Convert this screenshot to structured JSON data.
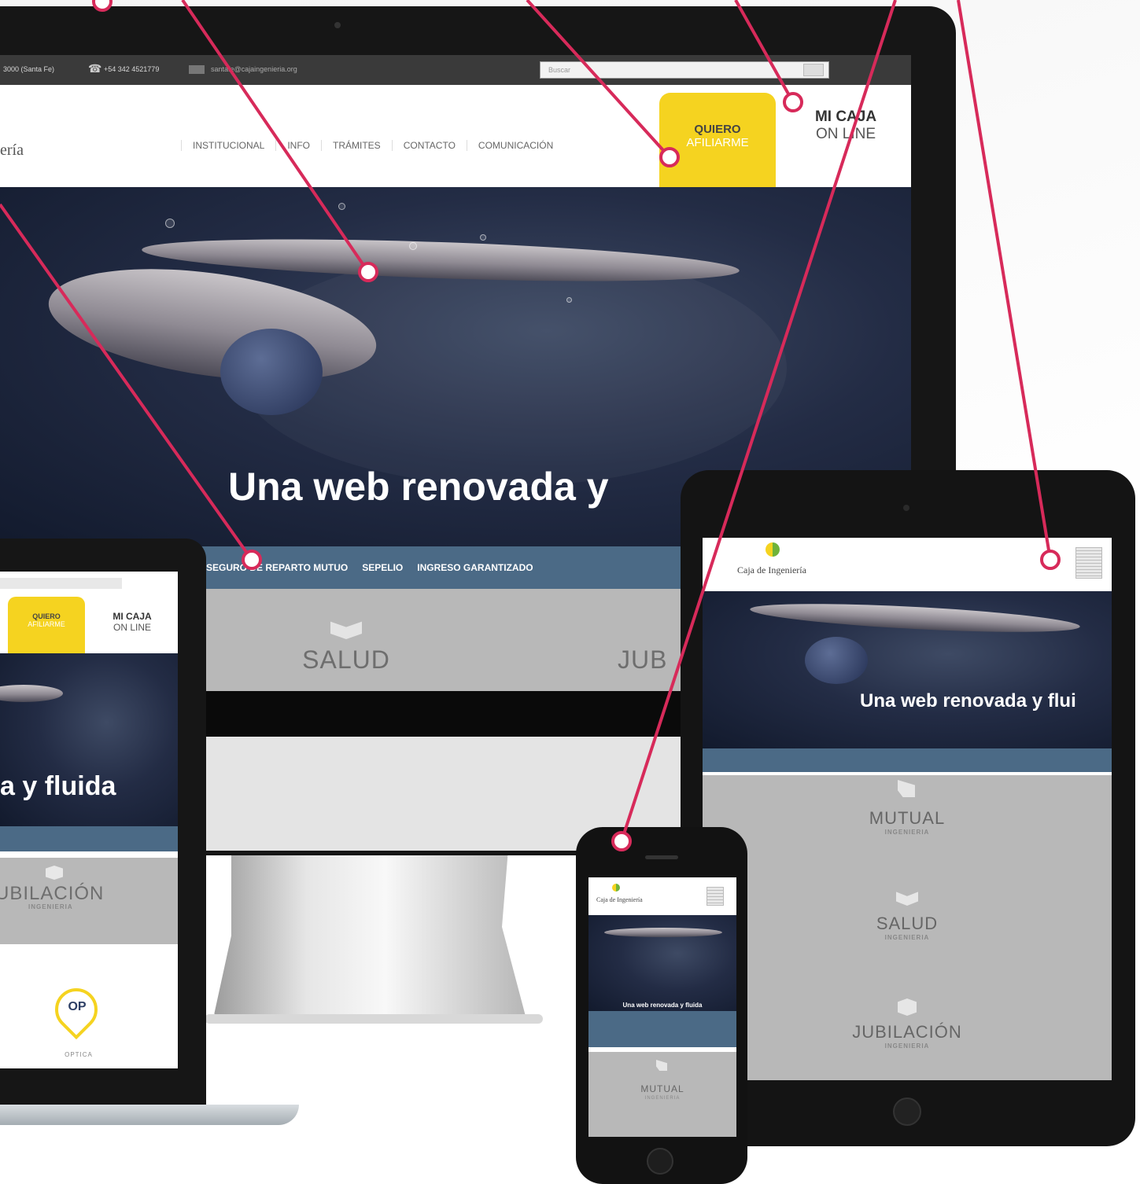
{
  "desktop": {
    "topbar": {
      "address": "3000 (Santa Fe)",
      "phone": "+54 342 4521779",
      "email": "santafe@cajaingenieria.org",
      "search_placeholder": "Buscar"
    },
    "logo_fragment": "ería",
    "menu": [
      "INSTITUCIONAL",
      "INFO",
      "TRÁMITES",
      "CONTACTO",
      "COMUNICACIÓN"
    ],
    "cta": {
      "line1": "QUIERO",
      "line2": "AFILIARME"
    },
    "online": {
      "line1": "MI CAJA",
      "line2": "ON LINE"
    },
    "hero_title": "Una web renovada y",
    "subnav": [
      "SEGURO DE REPARTO MUTUO",
      "SEPELIO",
      "INGRESO GARANTIZADO"
    ],
    "section_a": "SALUD",
    "section_b": "JUB"
  },
  "laptop": {
    "cta": {
      "line1": "QUIERO",
      "line2": "AFILIARME"
    },
    "online": {
      "line1": "MI CAJA",
      "line2": "ON LINE"
    },
    "hero_title": "a y fluida",
    "section": "UBILACIÓN",
    "section_sub": "INGENIERIA",
    "pin_label": "OP",
    "pin_caption": "OPTICA"
  },
  "tablet": {
    "logo": "Caja de Ingeniería",
    "hero_title": "Una web renovada y flui",
    "sections": [
      {
        "title": "MUTUAL",
        "sub": "INGENIERIA"
      },
      {
        "title": "SALUD",
        "sub": "INGENIERIA"
      },
      {
        "title": "JUBILACIÓN",
        "sub": "INGENIERIA"
      }
    ]
  },
  "phone": {
    "logo": "Caja de Ingeniería",
    "hero_title": "Una web renovada y fluida",
    "section": {
      "title": "MUTUAL",
      "sub": "INGENIERIA"
    }
  },
  "colors": {
    "accent": "#d72a5a",
    "yellow": "#f5d320",
    "navbar": "#4b6a86",
    "hero": "#232c45"
  }
}
